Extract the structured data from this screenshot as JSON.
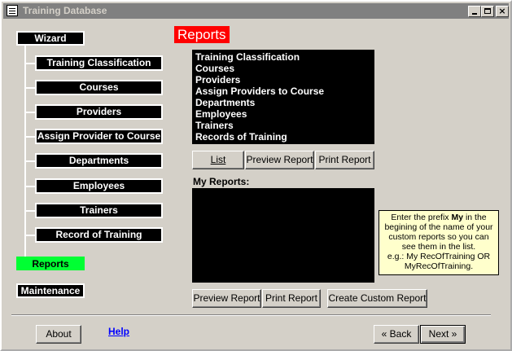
{
  "window": {
    "title": "Training Database",
    "title_icon": "form-icon",
    "controls": [
      "minimize-icon",
      "maximize-icon",
      "close-icon"
    ]
  },
  "wizard": {
    "label": "Wizard",
    "items": [
      {
        "label": "Training Classification"
      },
      {
        "label": "Courses"
      },
      {
        "label": "Providers"
      },
      {
        "label": "Assign Provider to Course"
      },
      {
        "label": "Departments"
      },
      {
        "label": "Employees"
      },
      {
        "label": "Trainers"
      },
      {
        "label": "Record of Training"
      }
    ],
    "active": {
      "label": "Reports",
      "color": "#00ff33"
    },
    "maintenance": {
      "label": "Maintenance"
    }
  },
  "reports": {
    "title": "Reports",
    "title_color": "#ff0000",
    "list": [
      "Training Classification",
      "Courses",
      "Providers",
      "Assign Providers to Course",
      "Departments",
      "Employees",
      "Trainers",
      "Records of Training"
    ],
    "list_button": "List",
    "preview_button": "Preview Report",
    "print_button": "Print Report"
  },
  "my_reports": {
    "label": "My Reports:",
    "preview_button": "Preview Report",
    "print_button": "Print Report",
    "create_button": "Create Custom Report",
    "hint": {
      "line1_pre": "Enter the prefix ",
      "line1_bold": "My",
      "line1_post": " in the",
      "line2": "begining of the name of your",
      "line3": "custom reports so you can",
      "line4": "see them in the list.",
      "line5": "e.g.: My RecOfTraining OR",
      "line6": "MyRecOfTraining."
    }
  },
  "footer": {
    "about_button": "About",
    "help_link": "Help",
    "back_button": "« Back",
    "next_button": "Next »"
  }
}
